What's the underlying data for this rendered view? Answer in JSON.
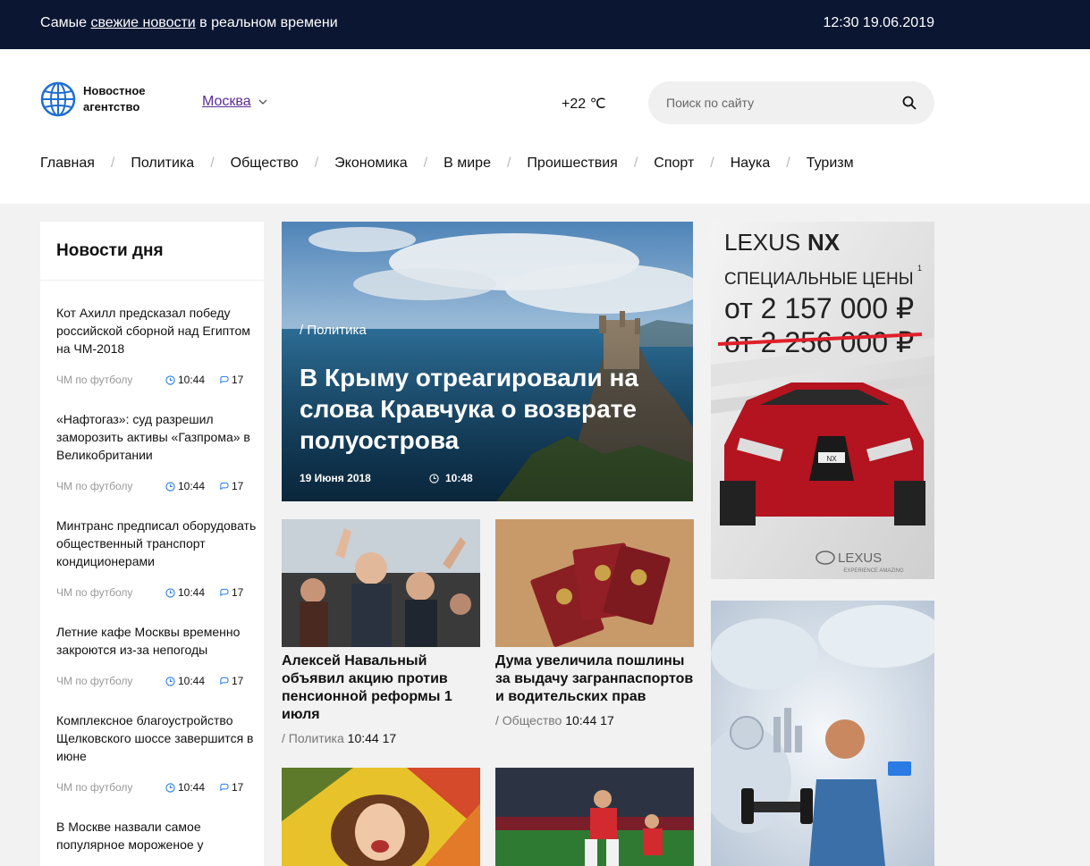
{
  "topbar": {
    "tagline_before": "Самые ",
    "tagline_link": "свежие новости",
    "tagline_after": " в реальном времени",
    "datetime": "12:30 19.06.2019"
  },
  "header": {
    "logo_line1": "Новостное",
    "logo_line2": "агентство",
    "city": "Москва",
    "temperature": "+22 ℃",
    "search_placeholder": "Поиск по сайту"
  },
  "nav": [
    "Главная",
    "Политика",
    "Общество",
    "Экономика",
    "В мире",
    "Проишествия",
    "Спорт",
    "Наука",
    "Туризм"
  ],
  "sidebar": {
    "title": "Новости дня",
    "items": [
      {
        "title": "Кот Ахилл предсказал победу российской сборной над Египтом на ЧМ-2018",
        "category": "ЧМ по футболу",
        "time": "10:44",
        "comments": "17"
      },
      {
        "title": "«Нафтогаз»: суд разрешил заморозить активы «Газпрома» в Великобритании",
        "category": "ЧМ по футболу",
        "time": "10:44",
        "comments": "17"
      },
      {
        "title": "Минтранс предписал оборудовать общественный транспорт кондиционерами",
        "category": "ЧМ по футболу",
        "time": "10:44",
        "comments": "17"
      },
      {
        "title": "Летние кафе Москвы временно закроются из-за непогоды",
        "category": "ЧМ по футболу",
        "time": "10:44",
        "comments": "17"
      },
      {
        "title": "Комплексное благоустройство Щелковского шоссе завершится в июне",
        "category": "ЧМ по футболу",
        "time": "10:44",
        "comments": "17"
      },
      {
        "title": "В Москве назвали самое популярное мороженое у",
        "category": "",
        "time": "",
        "comments": ""
      }
    ]
  },
  "hero": {
    "category": "/ Политика",
    "title": "В Крыму отреагировали на слова Кравчука о возврате полуострова",
    "date": "19 Июня 2018",
    "time": "10:48"
  },
  "cards": [
    {
      "title": "Алексей Навальный объявил акцию против пенсионной реформы 1 июля",
      "category": "/ Политика",
      "time": "10:44",
      "comments": "17"
    },
    {
      "title": "Дума увеличила пошлины за выдачу загранпаспортов и водительских прав",
      "category": "/ Общество",
      "time": "10:44",
      "comments": "17"
    }
  ],
  "ad_lexus": {
    "brand": "LEXUS",
    "model": "NX",
    "headline": "СПЕЦИАЛЬНЫЕ ЦЕНЫ",
    "footnote": "1",
    "price_new": "от 2 157 000 ₽",
    "price_old": "от 2 256 000 ₽",
    "plate": "NX",
    "logo_text": "LEXUS",
    "slogan": "EXPERIENCE AMAZING"
  },
  "colors": {
    "topbar_bg": "#0b1633",
    "city_link": "#5a2d91",
    "strike": "#e0202a"
  }
}
